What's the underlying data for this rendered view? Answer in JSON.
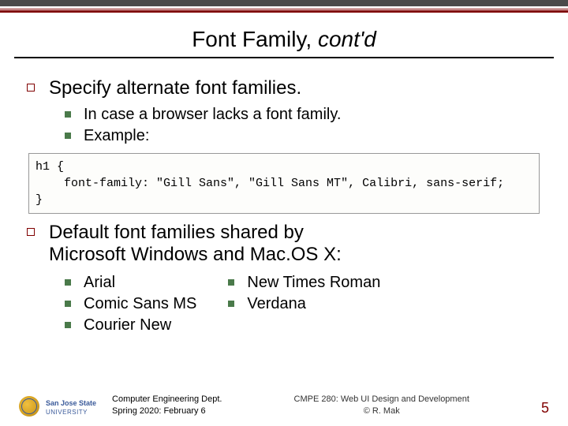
{
  "title_plain": "Font Family, ",
  "title_italic": "cont'd",
  "bullet1": "Specify alternate font families.",
  "sub1a": "In case a browser lacks a font family.",
  "sub1b": "Example:",
  "code": "h1 {\n    font-family: \"Gill Sans\", \"Gill Sans MT\", Calibri, sans-serif;\n}",
  "bullet2_line1": "Default font families shared by",
  "bullet2_line2": "Microsoft Windows and Mac.OS X:",
  "fonts_col1": [
    "Arial",
    "Comic Sans MS",
    "Courier New"
  ],
  "fonts_col2": [
    "New Times Roman",
    "Verdana"
  ],
  "footer_left_inst": "San Jose State",
  "footer_left_univ": "UNIVERSITY",
  "footer_dept1": "Computer Engineering Dept.",
  "footer_dept2": "Spring 2020: February 6",
  "footer_course1": "CMPE 280: Web UI Design and Development",
  "footer_course2": "© R. Mak",
  "page_number": "5"
}
